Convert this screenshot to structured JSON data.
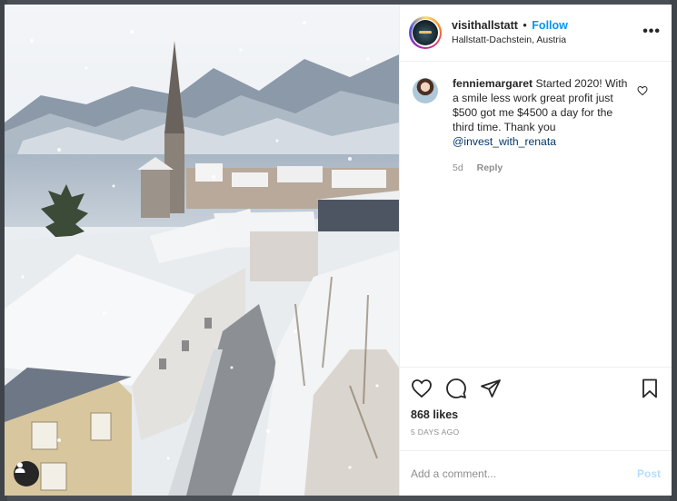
{
  "post": {
    "username": "visithallstatt",
    "separator": "•",
    "follow_label": "Follow",
    "location": "Hallstatt-Dachstein, Austria",
    "more_label": "•••",
    "photo_icon": "hallstatt-winter-village-photo",
    "user_tag_icon": "user-tag-icon"
  },
  "comment": {
    "username": "fenniemargaret",
    "text": "Started 2020! With a smile less work great profit just $500 got me $4500 a day for the third time. Thank you",
    "mention": "@invest_with_renata",
    "age": "5d",
    "reply_label": "Reply",
    "like_icon": "heart-icon"
  },
  "actions": {
    "like_icon": "heart-icon",
    "comment_icon": "comment-bubble-icon",
    "share_icon": "paper-plane-icon",
    "save_icon": "bookmark-icon"
  },
  "stats": {
    "likes": "868 likes",
    "timestamp": "5 DAYS AGO"
  },
  "composer": {
    "placeholder": "Add a comment...",
    "post_label": "Post"
  },
  "colors": {
    "accent": "#0095f6",
    "text": "#262626",
    "muted": "#8e8e8e",
    "post_disabled": "#b2dffc",
    "mention": "#00376b"
  }
}
